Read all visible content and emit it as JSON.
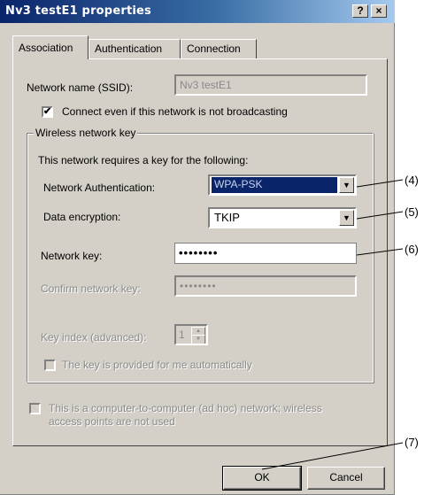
{
  "window": {
    "title": "Nv3 testE1 properties",
    "help_label": "?",
    "close_label": "×"
  },
  "tabs": [
    "Association",
    "Authentication",
    "Connection"
  ],
  "association": {
    "ssid_label": "Network name (SSID):",
    "ssid_value": "Nv3 testE1",
    "broadcast_check_label": "Connect even if this network is not broadcasting",
    "broadcast_checked": true,
    "group_title": "Wireless network key",
    "requires_text": "This network requires a key for the following:",
    "auth_label": "Network Authentication:",
    "auth_value": "WPA-PSK",
    "encryption_label": "Data encryption:",
    "encryption_value": "TKIP",
    "key_label": "Network key:",
    "key_value": "••••••••",
    "confirm_label": "Confirm network key:",
    "confirm_value": "••••••••",
    "index_label": "Key index (advanced):",
    "index_value": "1",
    "auto_key_label": "The key is provided for me automatically",
    "adhoc_line1": "This is a computer-to-computer (ad hoc) network; wireless",
    "adhoc_line2": "access points are not used"
  },
  "buttons": {
    "ok": "OK",
    "cancel": "Cancel"
  },
  "callouts": {
    "c4": "(4)",
    "c5": "(5)",
    "c6": "(6)",
    "c7": "(7)"
  }
}
